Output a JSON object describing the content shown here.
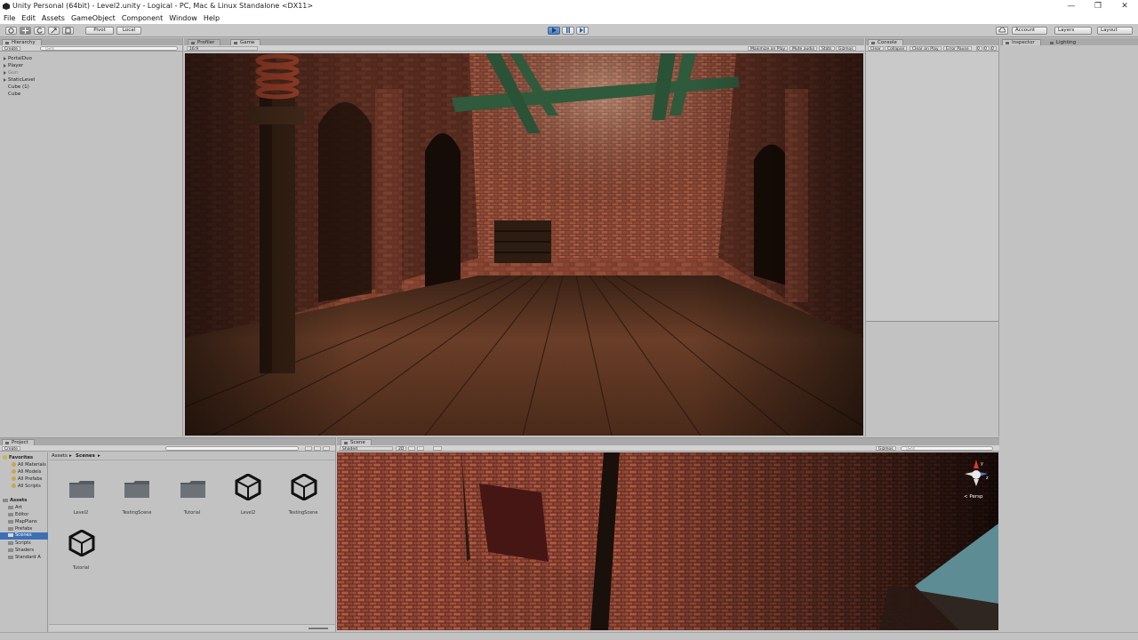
{
  "window": {
    "title": "Unity Personal (64bit) - Level2.unity - Logical - PC, Mac & Linux Standalone <DX11>",
    "minimize": "—",
    "restore": "❐",
    "close": "✕"
  },
  "menu": [
    "File",
    "Edit",
    "Assets",
    "GameObject",
    "Component",
    "Window",
    "Help"
  ],
  "toolbar": {
    "pivot_label": "Pivot",
    "local_label": "Local",
    "account_label": "Account",
    "layers_label": "Layers",
    "layout_label": "Layout"
  },
  "hierarchy": {
    "tab": "Hierarchy",
    "create_label": "Create",
    "search_placeholder": "Q▾All",
    "items": [
      {
        "label": "PortalDuo",
        "expandable": true,
        "muted": false
      },
      {
        "label": "Player",
        "expandable": true,
        "muted": false
      },
      {
        "label": "Gun",
        "expandable": true,
        "muted": true
      },
      {
        "label": "StaticLevel",
        "expandable": true,
        "muted": false
      },
      {
        "label": "Cube (1)",
        "expandable": false,
        "muted": false
      },
      {
        "label": "Cube",
        "expandable": false,
        "muted": false
      }
    ]
  },
  "game_panel": {
    "tabs": [
      "Profiler",
      "Game"
    ],
    "aspect": "16:9",
    "options": [
      "Maximize on Play",
      "Mute audio",
      "Stats",
      "Gizmos"
    ]
  },
  "console": {
    "tab": "Console",
    "buttons": [
      "Clear",
      "Collapse",
      "Clear on Play",
      "Error Pause"
    ],
    "counts": [
      "0",
      "0",
      "0"
    ]
  },
  "inspector": {
    "tabs": [
      "Inspector",
      "Lighting"
    ]
  },
  "project": {
    "tab": "Project",
    "create_label": "Create",
    "breadcrumb": [
      "Assets",
      "Scenes"
    ],
    "favorites_label": "Favorites",
    "favorites": [
      "All Materials",
      "All Models",
      "All Prefabs",
      "All Scripts"
    ],
    "assets_label": "Assets",
    "folders": [
      "Art",
      "Editor",
      "MapPlans",
      "Prefabs",
      "Scenes",
      "Scripts",
      "Shaders",
      "Standard A"
    ],
    "selected_folder": "Scenes",
    "grid": [
      {
        "label": "Level2",
        "kind": "folder"
      },
      {
        "label": "TestingScene",
        "kind": "folder"
      },
      {
        "label": "Tutorial",
        "kind": "folder"
      },
      {
        "label": "Level2",
        "kind": "unity"
      },
      {
        "label": "TestingScene",
        "kind": "unity"
      },
      {
        "label": "Tutorial",
        "kind": "unity"
      }
    ]
  },
  "scene_panel": {
    "tab": "Scene",
    "shading": "Shaded",
    "mode_2d": "2D",
    "gizmos": "Gizmos",
    "search_placeholder": "Q▾All",
    "persp_label": "< Persp"
  },
  "colors": {
    "play_active": "#4d7fbf",
    "panel_bg": "#c2c2c2",
    "selection": "#3d6fb6"
  }
}
